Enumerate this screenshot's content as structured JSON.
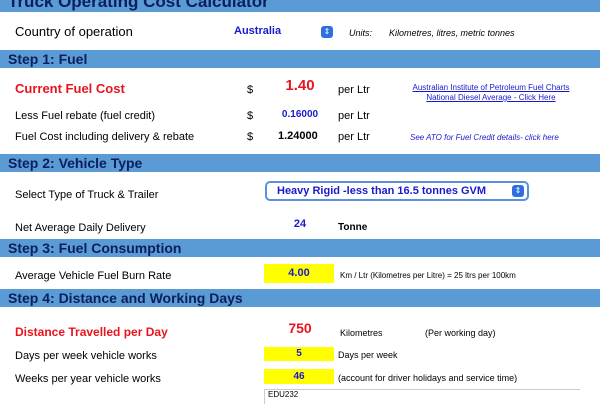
{
  "title": "Truck Operating Cost Calculator",
  "country": {
    "label": "Country of operation",
    "value": "Australia",
    "units_label": "Units:",
    "units_value": "Kilometres, litres, metric tonnes"
  },
  "step1": {
    "heading": "Step 1: Fuel",
    "current_cost": {
      "label": "Current Fuel Cost",
      "currency": "$",
      "value": "1.40",
      "unit": "per Ltr"
    },
    "rebate": {
      "label": "Less Fuel rebate (fuel credit)",
      "currency": "$",
      "value": "0.16000",
      "unit": "per Ltr"
    },
    "net": {
      "label": "Fuel Cost including delivery & rebate",
      "currency": "$",
      "value": "1.24000",
      "unit": "per Ltr"
    },
    "aip_link_line1": "Australian Institute of Petroleum Fuel Charts",
    "aip_link_line2": "National Diesel Average - Click Here",
    "ato_link": "See ATO for Fuel Credit details- click here"
  },
  "step2": {
    "heading": "Step 2: Vehicle Type",
    "truck_type": {
      "label": "Select Type of Truck & Trailer",
      "value": "Heavy Rigid -less than 16.5 tonnes GVM"
    },
    "delivery": {
      "label": "Net Average Daily Delivery",
      "value": "24",
      "unit": "Tonne"
    }
  },
  "step3": {
    "heading": "Step 3: Fuel Consumption",
    "burn": {
      "label": "Average Vehicle Fuel Burn Rate",
      "value": "4.00",
      "unit": "Km / Ltr (Kilometres per Litre) = 25 ltrs per 100km"
    }
  },
  "step4": {
    "heading": "Step 4: Distance and Working Days",
    "distance": {
      "label": "Distance Travelled per Day",
      "value": "750",
      "unit": "Kilometres",
      "note": "(Per working day)"
    },
    "days": {
      "label": "Days per week vehicle works",
      "value": "5",
      "unit": "Days per week"
    },
    "weeks": {
      "label": "Weeks per year vehicle works",
      "value": "46",
      "unit": "(account for driver holidays and service time)"
    },
    "partial_text": "EDU232"
  },
  "colors": {
    "banner": "#5b9bd5",
    "banner_text": "#0a1f5c",
    "highlight": "#ffff00",
    "red": "#e8141e",
    "link_blue": "#1a1acd"
  }
}
